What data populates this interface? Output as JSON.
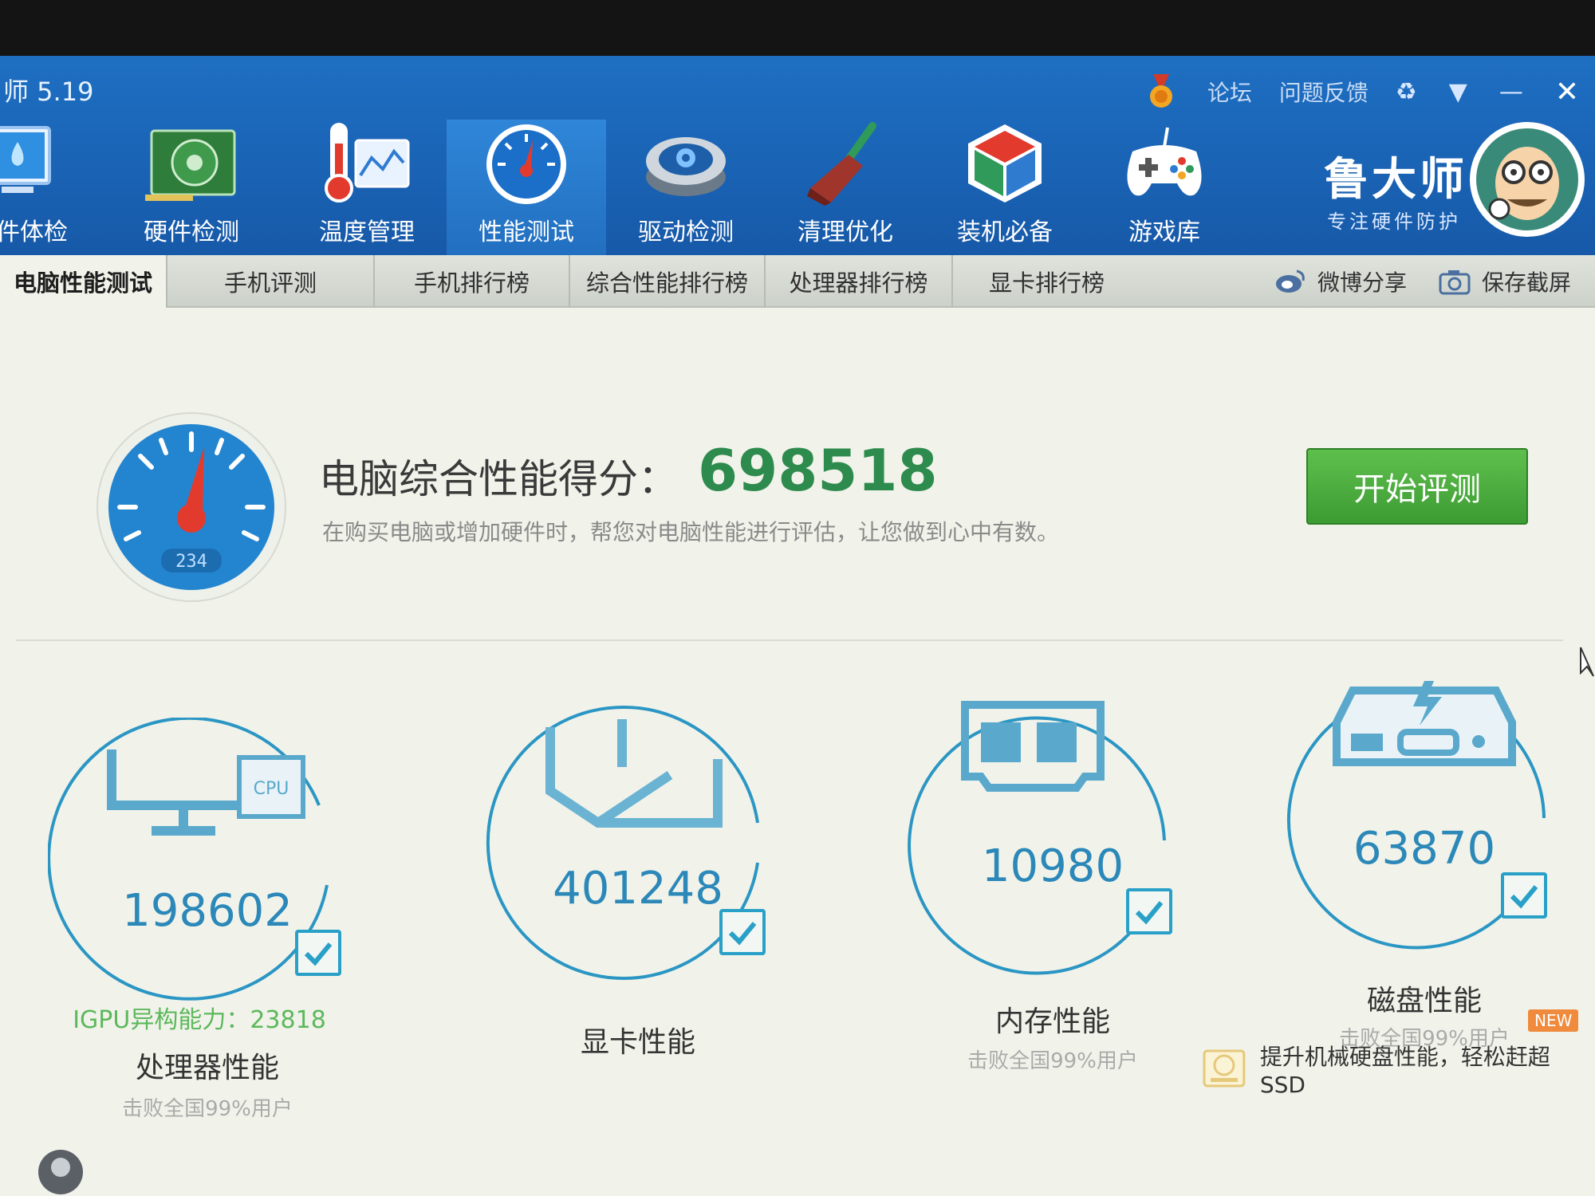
{
  "window": {
    "title": "师 5.19",
    "links": [
      "论坛",
      "问题反馈"
    ],
    "controls": [
      "minimize",
      "close"
    ]
  },
  "nav": [
    {
      "label": "件体检",
      "icon": "monitor-health-icon"
    },
    {
      "label": "硬件检测",
      "icon": "graphics-card-icon"
    },
    {
      "label": "温度管理",
      "icon": "thermometer-icon"
    },
    {
      "label": "性能测试",
      "icon": "speedometer-icon",
      "active": true
    },
    {
      "label": "驱动检测",
      "icon": "driver-gear-icon"
    },
    {
      "label": "清理优化",
      "icon": "broom-icon"
    },
    {
      "label": "装机必备",
      "icon": "cube-box-icon"
    },
    {
      "label": "游戏库",
      "icon": "gamepad-icon"
    }
  ],
  "brand": {
    "name": "鲁大师",
    "slogan": "专注硬件防护"
  },
  "tabs": [
    {
      "label": "电脑性能测试",
      "active": true
    },
    {
      "label": "手机评测"
    },
    {
      "label": "手机排行榜"
    },
    {
      "label": "综合性能排行榜"
    },
    {
      "label": "处理器排行榜"
    },
    {
      "label": "显卡排行榜"
    }
  ],
  "tab_actions": {
    "share": "微博分享",
    "screenshot": "保存截屏"
  },
  "score": {
    "label": "电脑综合性能得分：",
    "value": "698518",
    "description": "在购买电脑或增加硬件时，帮您对电脑性能进行评估，让您做到心中有数。",
    "gauge_number": "234",
    "start_button": "开始评测"
  },
  "cards": [
    {
      "score": "198602",
      "extra": "IGPU异构能力：23818",
      "label": "处理器性能",
      "sub": "击败全国99%用户",
      "chip_text": "CPU"
    },
    {
      "score": "401248",
      "label": "显卡性能"
    },
    {
      "score": "10980",
      "label": "内存性能",
      "sub": "击败全国99%用户"
    },
    {
      "score": "63870",
      "label": "磁盘性能",
      "sub": "击败全国99%用户"
    }
  ],
  "ssd_banner": {
    "text": "提升机械硬盘性能，轻松赶超SSD",
    "badge": "NEW"
  },
  "colors": {
    "header_blue": "#1a63b5",
    "score_green": "#2e8b4e",
    "ring_blue": "#2b96c4",
    "button_green": "#4caf40"
  }
}
